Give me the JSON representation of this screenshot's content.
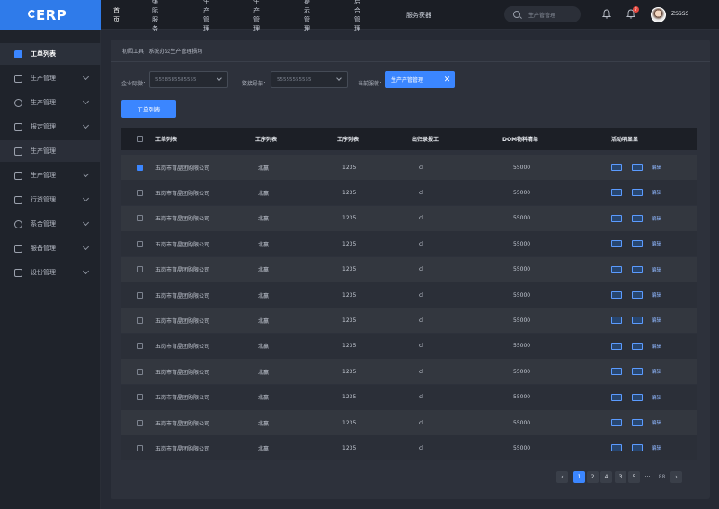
{
  "app": {
    "logo": "ERP"
  },
  "topnav": [
    {
      "label": "首页",
      "active": true
    },
    {
      "label": "强际服务",
      "active": false
    },
    {
      "label": "生产管理",
      "active": false
    },
    {
      "label": "生产管理",
      "active": false
    },
    {
      "label": "提示管理",
      "active": false
    },
    {
      "label": "后合管理",
      "active": false
    },
    {
      "label": "服务获器",
      "active": false
    }
  ],
  "search": {
    "placeholder": "生产管管理"
  },
  "notifications": {
    "count": "7"
  },
  "user": {
    "name": "ZSSSS"
  },
  "sidebar": {
    "items": [
      {
        "label": "工单列表",
        "icon": "home-icon",
        "active": true
      },
      {
        "label": "生产管理",
        "icon": "chart-icon"
      },
      {
        "label": "生产管理",
        "icon": "location-icon"
      },
      {
        "label": "报定管理",
        "icon": "document-icon"
      },
      {
        "label": "生产管理",
        "icon": "file-icon",
        "selected": true
      },
      {
        "label": "生产管理",
        "icon": "users-icon"
      },
      {
        "label": "行资管理",
        "icon": "wallet-icon"
      },
      {
        "label": "系合管理",
        "icon": "settings-icon"
      },
      {
        "label": "服备管理",
        "icon": "box-icon"
      },
      {
        "label": "设份管理",
        "icon": "clipboard-icon"
      }
    ]
  },
  "breadcrumb": "初因工具 ∶ 系统办公生产管理损场",
  "filters": {
    "company_label": "企业际微：",
    "company_value": "5558585585555",
    "account_label": "繁接号前：",
    "account_value": "55555555555",
    "status_label": "当前服就：",
    "tag_label": "生产产管管理",
    "tag_close": "✕"
  },
  "toolbar": {
    "primary_label": "工单列表"
  },
  "table": {
    "headers": [
      "工单列表",
      "工序列表",
      "工序列表",
      "出归录报工",
      "DOM物料清单",
      "活动明显显"
    ],
    "rows": [
      {
        "name": "五岗市育晶团购限公司",
        "city": "北赢",
        "num": "1235",
        "cl": "cl",
        "amt": "55000",
        "action": "编辑",
        "checked": true
      },
      {
        "name": "五岗市育晶团购限公司",
        "city": "北赢",
        "num": "1235",
        "cl": "cl",
        "amt": "55000",
        "action": "编辑",
        "checked": false
      },
      {
        "name": "五岗市育晶团购限公司",
        "city": "北赢",
        "num": "1235",
        "cl": "cl",
        "amt": "55000",
        "action": "编辑",
        "checked": false
      },
      {
        "name": "五岗市育晶团购限公司",
        "city": "北赢",
        "num": "1235",
        "cl": "cl",
        "amt": "55000",
        "action": "编辑",
        "checked": false
      },
      {
        "name": "五岗市育晶团购限公司",
        "city": "北赢",
        "num": "1235",
        "cl": "cl",
        "amt": "55000",
        "action": "编辑",
        "checked": false
      },
      {
        "name": "五岗市育晶团购限公司",
        "city": "北赢",
        "num": "1235",
        "cl": "cl",
        "amt": "55000",
        "action": "编辑",
        "checked": false
      },
      {
        "name": "五岗市育晶团购限公司",
        "city": "北赢",
        "num": "1235",
        "cl": "cl",
        "amt": "55000",
        "action": "编辑",
        "checked": false
      },
      {
        "name": "五岗市育晶团购限公司",
        "city": "北赢",
        "num": "1235",
        "cl": "cl",
        "amt": "55000",
        "action": "编辑",
        "checked": false
      },
      {
        "name": "五岗市育晶团购限公司",
        "city": "北赢",
        "num": "1235",
        "cl": "cl",
        "amt": "55000",
        "action": "编辑",
        "checked": false
      },
      {
        "name": "五岗市育晶团购限公司",
        "city": "北赢",
        "num": "1235",
        "cl": "cl",
        "amt": "55000",
        "action": "编辑",
        "checked": false
      },
      {
        "name": "五岗市育晶团购限公司",
        "city": "北赢",
        "num": "1235",
        "cl": "cl",
        "amt": "55000",
        "action": "编辑",
        "checked": false
      },
      {
        "name": "五岗市育晶团购限公司",
        "city": "北赢",
        "num": "1235",
        "cl": "cl",
        "amt": "55000",
        "action": "编辑",
        "checked": false
      }
    ]
  },
  "pagination": {
    "prev": "‹",
    "pages": [
      "1",
      "2",
      "4",
      "3",
      "5"
    ],
    "current": "1",
    "ellipsis": "···",
    "extra": "88",
    "next": "›"
  },
  "colors": {
    "accent": "#3b86ff",
    "topbar": "#1b1e25",
    "sidebar": "#1f232b",
    "panel": "#2d313b",
    "badge": "#e5483f"
  }
}
